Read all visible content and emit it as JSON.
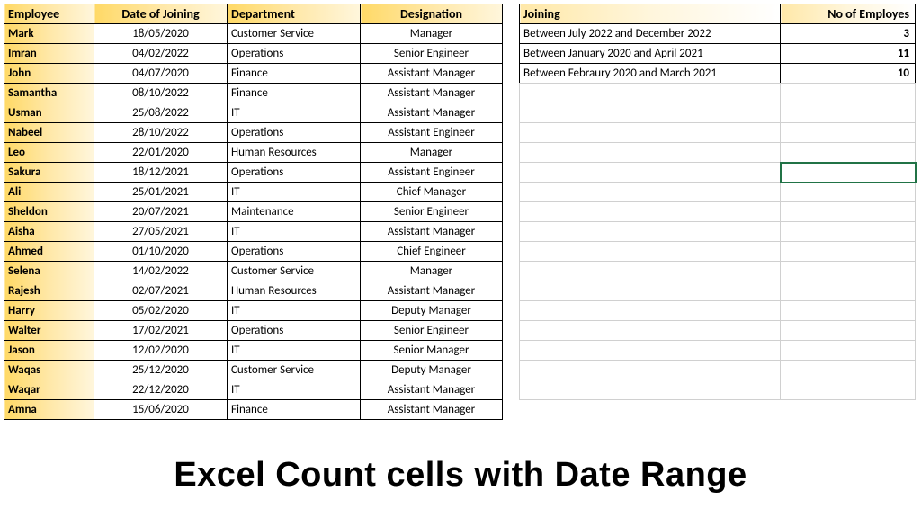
{
  "main_headers": {
    "employee": "Employee",
    "date": "Date of Joining",
    "dept": "Department",
    "desig": "Designation"
  },
  "employees": [
    {
      "name": "Mark",
      "date": "18/05/2020",
      "dept": "Customer Service",
      "desig": "Manager"
    },
    {
      "name": "Imran",
      "date": "04/02/2022",
      "dept": "Operations",
      "desig": "Senior Engineer"
    },
    {
      "name": "John",
      "date": "04/07/2020",
      "dept": "Finance",
      "desig": "Assistant Manager"
    },
    {
      "name": "Samantha",
      "date": "08/10/2022",
      "dept": "Finance",
      "desig": "Assistant Manager"
    },
    {
      "name": "Usman",
      "date": "25/08/2022",
      "dept": "IT",
      "desig": "Assistant Manager"
    },
    {
      "name": "Nabeel",
      "date": "28/10/2022",
      "dept": "Operations",
      "desig": "Assistant Engineer"
    },
    {
      "name": "Leo",
      "date": "22/01/2020",
      "dept": "Human Resources",
      "desig": "Manager"
    },
    {
      "name": "Sakura",
      "date": "18/12/2021",
      "dept": "Operations",
      "desig": "Assistant Engineer"
    },
    {
      "name": "Ali",
      "date": "25/01/2021",
      "dept": "IT",
      "desig": "Chief Manager"
    },
    {
      "name": "Sheldon",
      "date": "20/07/2021",
      "dept": "Maintenance",
      "desig": "Senior Engineer"
    },
    {
      "name": "Aisha",
      "date": "27/05/2021",
      "dept": "IT",
      "desig": "Assistant Manager"
    },
    {
      "name": "Ahmed",
      "date": "01/10/2020",
      "dept": "Operations",
      "desig": "Chief Engineer"
    },
    {
      "name": "Selena",
      "date": "14/02/2022",
      "dept": "Customer Service",
      "desig": "Manager"
    },
    {
      "name": "Rajesh",
      "date": "02/07/2021",
      "dept": "Human Resources",
      "desig": "Assistant Manager"
    },
    {
      "name": "Harry",
      "date": "05/02/2020",
      "dept": "IT",
      "desig": "Deputy Manager"
    },
    {
      "name": "Walter",
      "date": "17/02/2021",
      "dept": "Operations",
      "desig": "Senior Engineer"
    },
    {
      "name": "Jason",
      "date": "12/02/2020",
      "dept": "IT",
      "desig": "Senior Manager"
    },
    {
      "name": "Waqas",
      "date": "25/12/2020",
      "dept": "Customer Service",
      "desig": "Deputy Manager"
    },
    {
      "name": "Waqar",
      "date": "22/12/2020",
      "dept": "IT",
      "desig": "Assistant Manager"
    },
    {
      "name": "Amna",
      "date": "15/06/2020",
      "dept": "Finance",
      "desig": "Assistant Manager"
    }
  ],
  "summary_headers": {
    "joining": "Joining",
    "count": "No of Employes"
  },
  "summary": [
    {
      "label": "Between July 2022 and December 2022",
      "count": "3"
    },
    {
      "label": "Between January 2020 and April 2021",
      "count": "11"
    },
    {
      "label": "Between Febraury 2020 and March 2021",
      "count": "10"
    }
  ],
  "caption": "Excel Count cells with Date Range"
}
